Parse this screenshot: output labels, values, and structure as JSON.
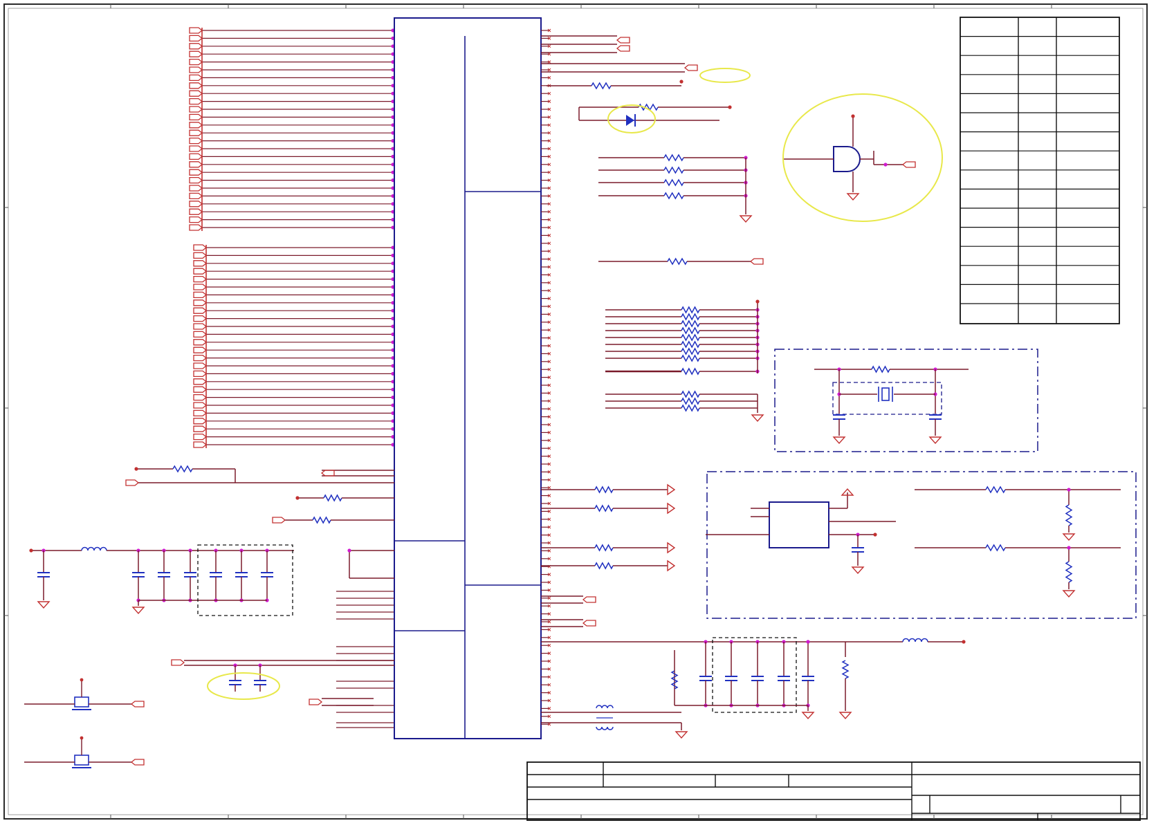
{
  "colors": {
    "frame": "#2a2a2a",
    "ic_body": "#1a1a8c",
    "wire": "#7a1a2a",
    "net_pin": "#c23030",
    "resistor": "#2030c0",
    "junction": "#d01ad0",
    "highlight": "#e8e84a",
    "table_line": "#111111"
  },
  "icons": {
    "resistor": "zigzag-resistor-icon",
    "capacitor": "capacitor-icon",
    "inductor": "inductor-coil-icon",
    "ground": "ground-triangle-icon",
    "diode": "diode-icon",
    "and_gate": "and-gate-icon",
    "crystal": "crystal-oscillator-icon",
    "mosfet": "mosfet-transistor-icon",
    "offpage_connector": "offpage-connector-icon"
  },
  "highlights": [
    "net-label-highlight",
    "diode-highlight",
    "logic-gate-highlight",
    "capacitor-pair-highlight"
  ]
}
